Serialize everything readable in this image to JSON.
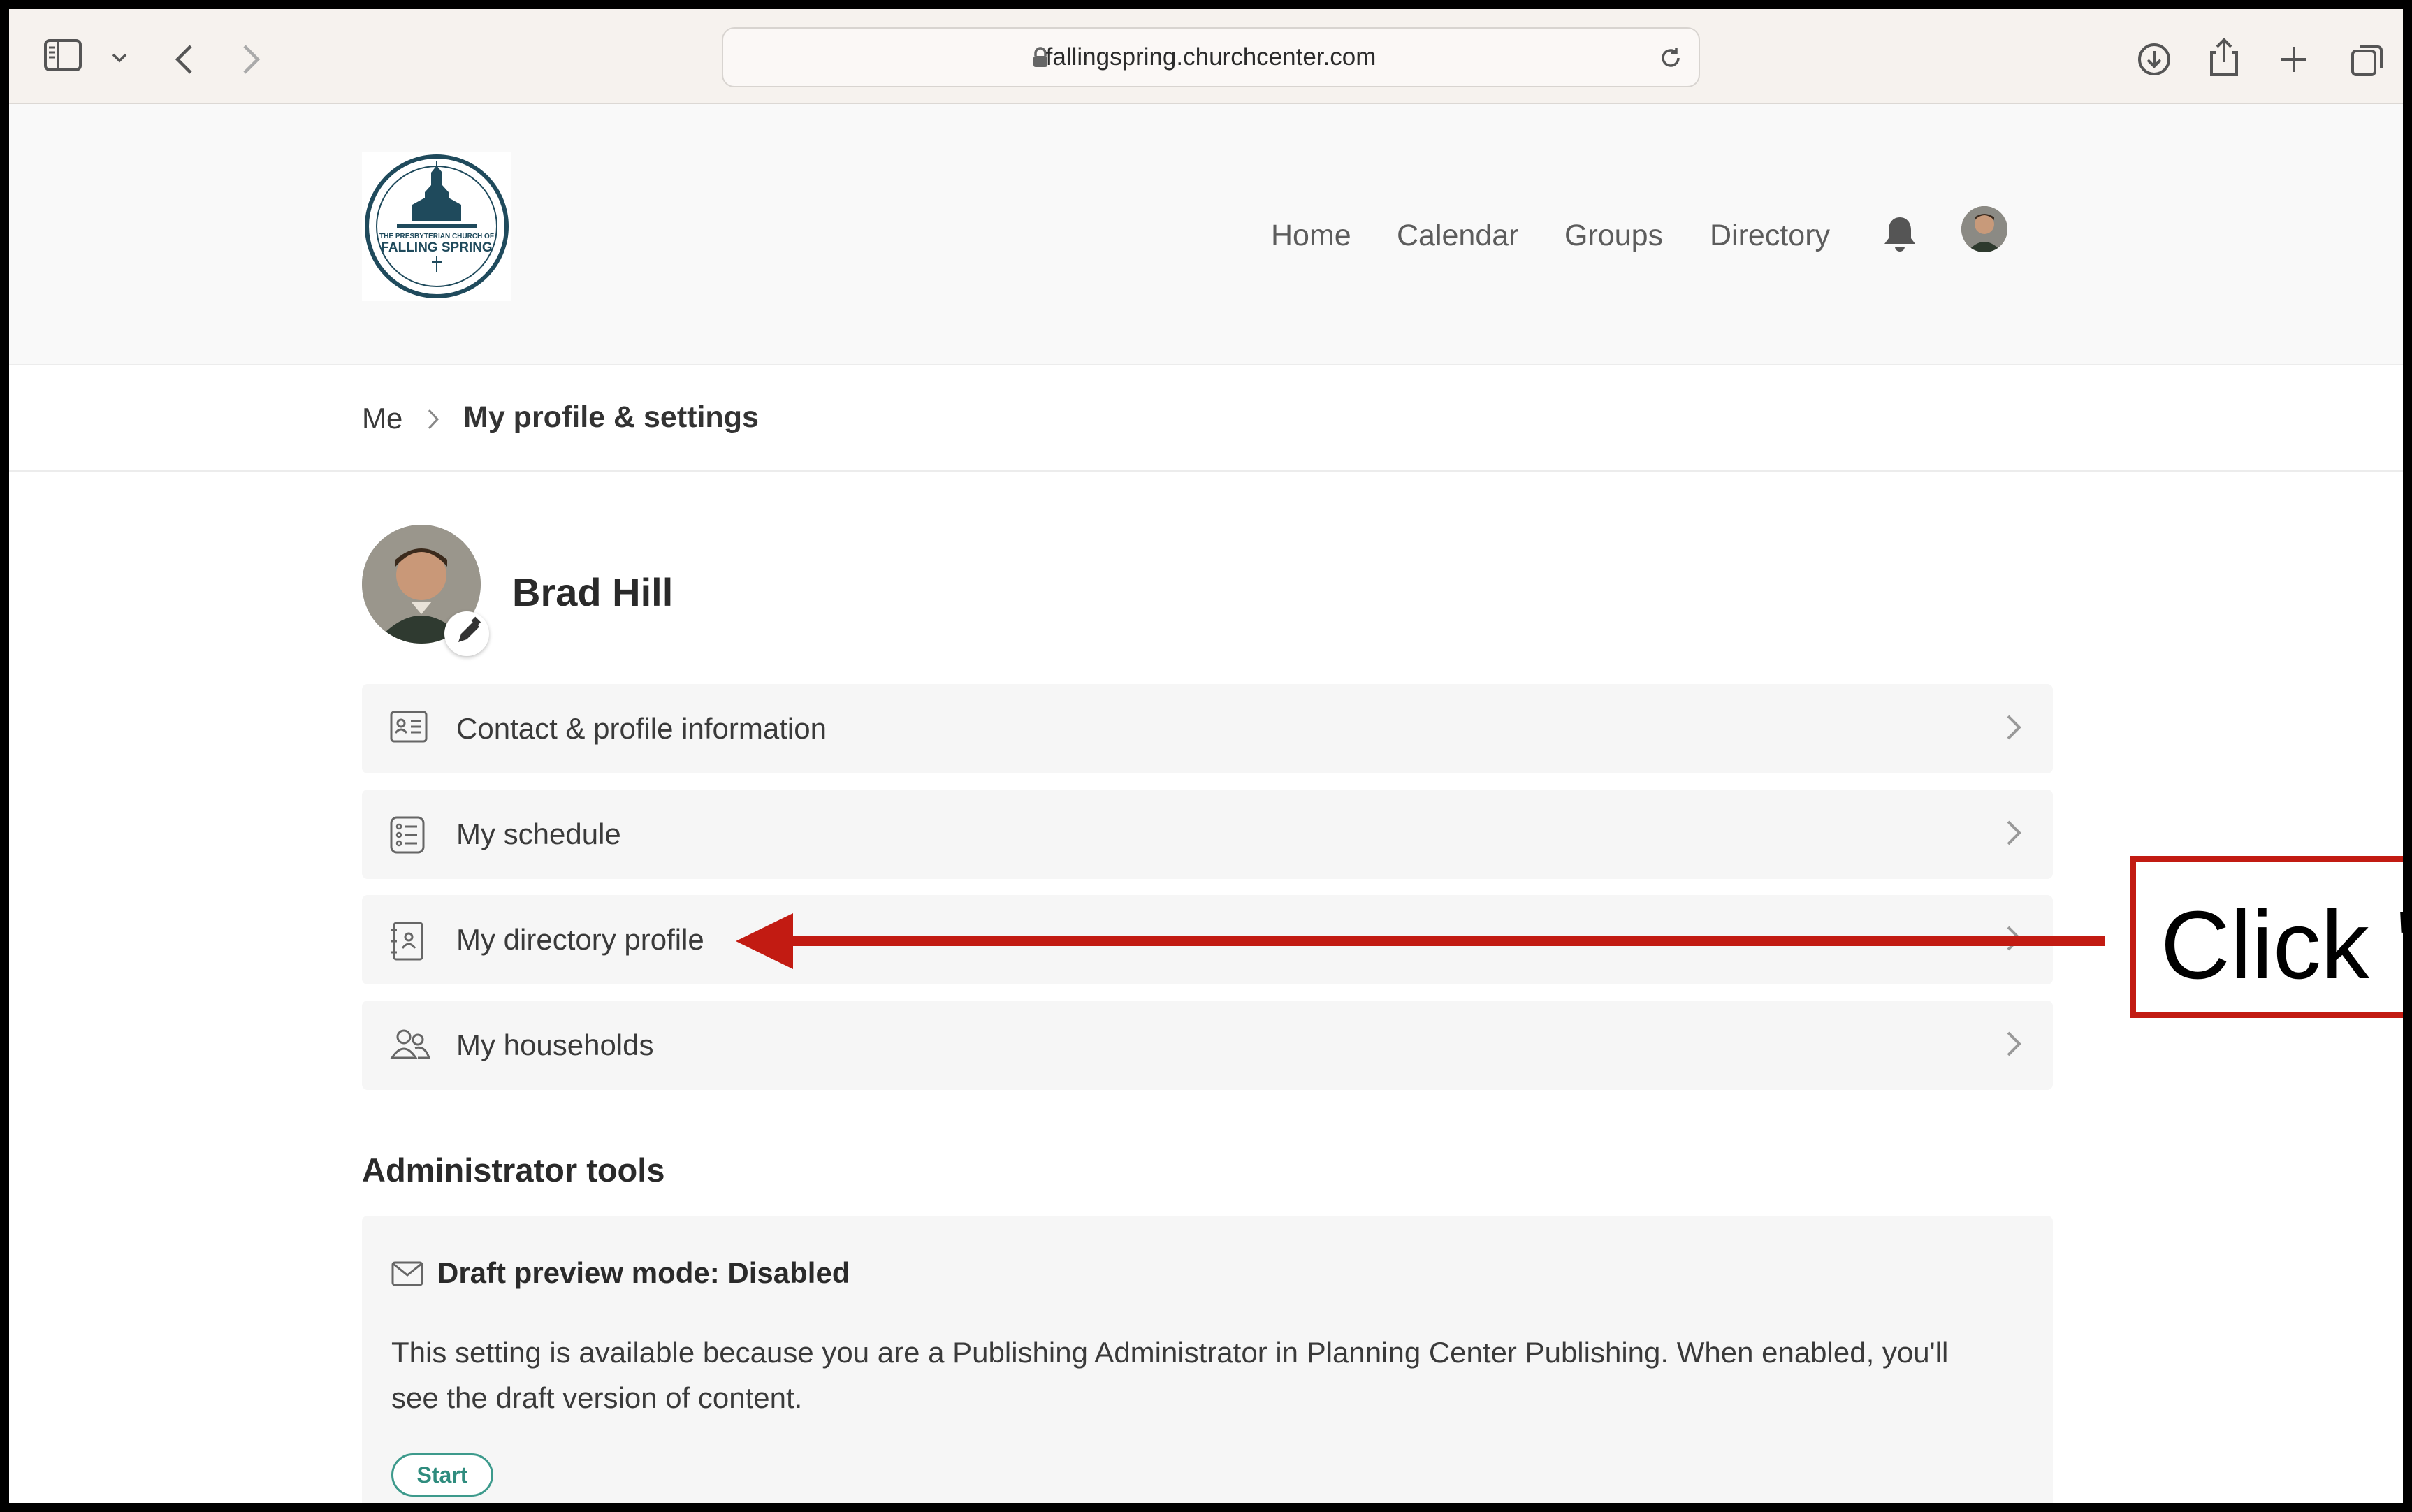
{
  "browser": {
    "url": "fallingspring.churchcenter.com"
  },
  "site": {
    "logo_text": "THE PRESBYTERIAN CHURCH OF FALLING SPRING",
    "nav": [
      "Home",
      "Calendar",
      "Groups",
      "Directory"
    ]
  },
  "breadcrumb": {
    "parent": "Me",
    "current": "My profile & settings"
  },
  "profile": {
    "name": "Brad Hill"
  },
  "menu": [
    {
      "label": "Contact & profile information",
      "icon": "contact-card-icon"
    },
    {
      "label": "My schedule",
      "icon": "list-icon"
    },
    {
      "label": "My directory profile",
      "icon": "directory-book-icon"
    },
    {
      "label": "My households",
      "icon": "people-icon"
    }
  ],
  "admin": {
    "title": "Administrator tools",
    "card_title": "Draft preview mode: Disabled",
    "description": "This setting is available because you are a Publishing Administrator in Planning Center Publishing. When enabled, you'll see the draft version of content.",
    "button": "Start"
  },
  "annotation": {
    "callout_text": "Click \"",
    "color": "#c21b12"
  },
  "colors": {
    "accent": "#2f8c7e",
    "annotation_red": "#c21b12"
  }
}
